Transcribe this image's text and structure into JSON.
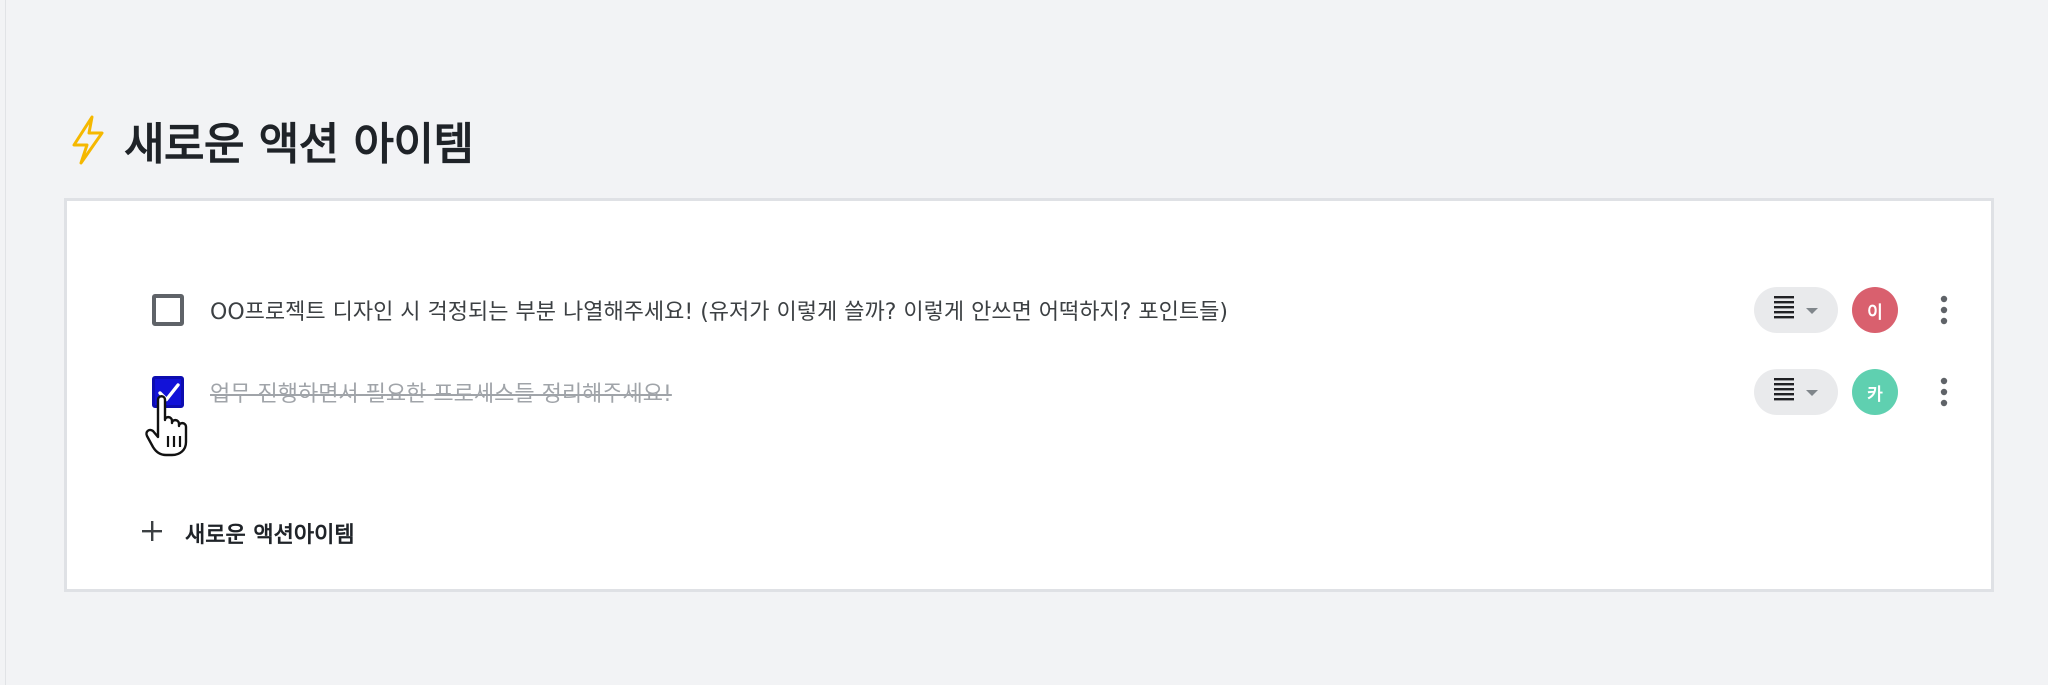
{
  "section": {
    "title": "새로운 액션 아이템",
    "icon": "lightning-bolt-icon",
    "icon_color": "#f5b800"
  },
  "action_items": [
    {
      "text": "OO프로젝트 디자인 시 걱정되는 부분 나열해주세요! (유저가 이렇게 쓸까? 이렇게 안쓰면 어떡하지? 포인트들)",
      "checked": false,
      "assignee_initial": "이",
      "assignee_color": "#d9606e"
    },
    {
      "text": "업무 진행하면서 필요한 프로세스들 정리해주세요!",
      "checked": true,
      "assignee_initial": "카",
      "assignee_color": "#5fd0b0"
    }
  ],
  "add_action": {
    "label": "새로운 액션아이템"
  },
  "colors": {
    "checkbox_checked": "#1212d8",
    "page_background": "#f2f3f5"
  }
}
